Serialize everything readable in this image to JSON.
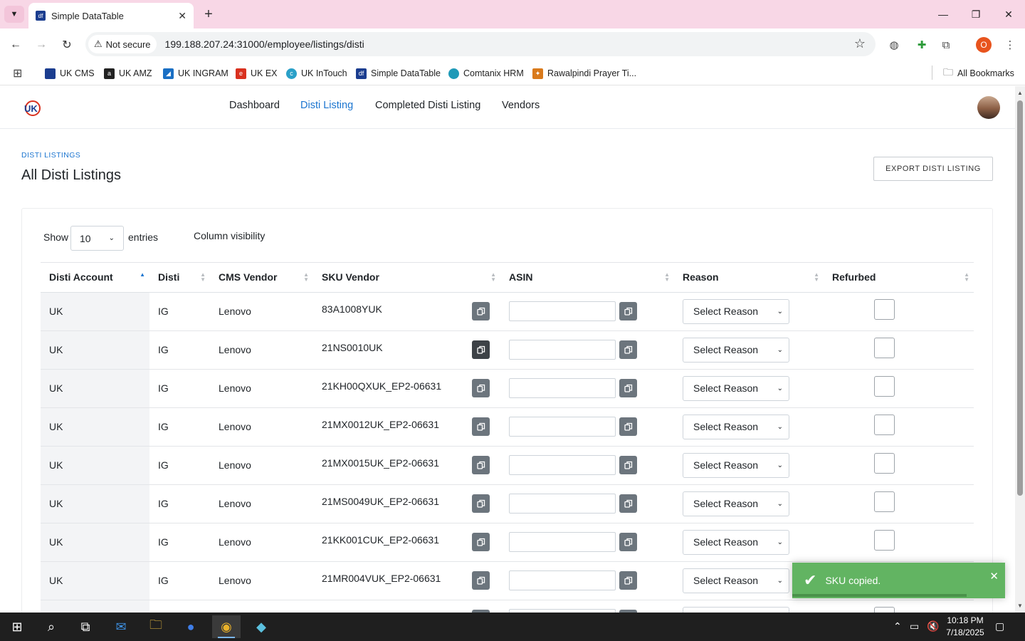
{
  "browser": {
    "tab_title": "Simple DataTable",
    "favicon_text": "df",
    "security_label": "Not secure",
    "url": "199.188.207.24:31000/employee/listings/disti",
    "bookmarks": [
      {
        "label": "UK CMS",
        "color": "#1b3d8f",
        "glyph": "▪"
      },
      {
        "label": "UK AMZ",
        "color": "#222222",
        "glyph": "a"
      },
      {
        "label": "UK INGRAM",
        "color": "#1a6fc4",
        "glyph": "◢"
      },
      {
        "label": "UK EX",
        "color": "#d9311f",
        "glyph": "e"
      },
      {
        "label": "UK InTouch",
        "color": "#2aa0c8",
        "glyph": "©"
      },
      {
        "label": "Simple DataTable",
        "color": "#1b3d8f",
        "glyph": "df"
      },
      {
        "label": "Comtanix HRM",
        "color": "#1f9ab8",
        "glyph": "●"
      },
      {
        "label": "Rawalpindi Prayer Ti...",
        "color": "#d97a1c",
        "glyph": "◆"
      }
    ],
    "all_bookmarks_label": "All Bookmarks",
    "profile_initial": "O"
  },
  "app": {
    "nav": [
      {
        "label": "Dashboard",
        "active": false
      },
      {
        "label": "Disti Listing",
        "active": true
      },
      {
        "label": "Completed Disti Listing",
        "active": false
      },
      {
        "label": "Vendors",
        "active": false
      }
    ],
    "accent_color": "#1b75d0"
  },
  "page": {
    "breadcrumb": "DISTI LISTINGS",
    "title": "All Disti Listings",
    "export_button": "EXPORT DISTI LISTING"
  },
  "table_controls": {
    "show_label": "Show",
    "entries_value": "10",
    "entries_label": "entries",
    "column_visibility": "Column visibility"
  },
  "table": {
    "columns": [
      "Disti Account",
      "Disti",
      "CMS Vendor",
      "SKU Vendor",
      "ASIN",
      "Reason",
      "Refurbed"
    ],
    "reason_placeholder": "Select Reason",
    "rows": [
      {
        "account": "UK",
        "disti": "IG",
        "vendor": "Lenovo",
        "sku": "83A1008YUK"
      },
      {
        "account": "UK",
        "disti": "IG",
        "vendor": "Lenovo",
        "sku": "21NS0010UK"
      },
      {
        "account": "UK",
        "disti": "IG",
        "vendor": "Lenovo",
        "sku": "21KH00QXUK_EP2-06631"
      },
      {
        "account": "UK",
        "disti": "IG",
        "vendor": "Lenovo",
        "sku": "21MX0012UK_EP2-06631"
      },
      {
        "account": "UK",
        "disti": "IG",
        "vendor": "Lenovo",
        "sku": "21MX0015UK_EP2-06631"
      },
      {
        "account": "UK",
        "disti": "IG",
        "vendor": "Lenovo",
        "sku": "21MS0049UK_EP2-06631"
      },
      {
        "account": "UK",
        "disti": "IG",
        "vendor": "Lenovo",
        "sku": "21KK001CUK_EP2-06631"
      },
      {
        "account": "UK",
        "disti": "IG",
        "vendor": "Lenovo",
        "sku": "21MR004VUK_EP2-06631"
      },
      {
        "account": "",
        "disti": "",
        "vendor": "",
        "sku": ""
      }
    ]
  },
  "toast": {
    "message": "SKU copied.",
    "color": "#62b462"
  },
  "taskbar": {
    "time": "10:18 PM",
    "date": "7/18/2025"
  }
}
